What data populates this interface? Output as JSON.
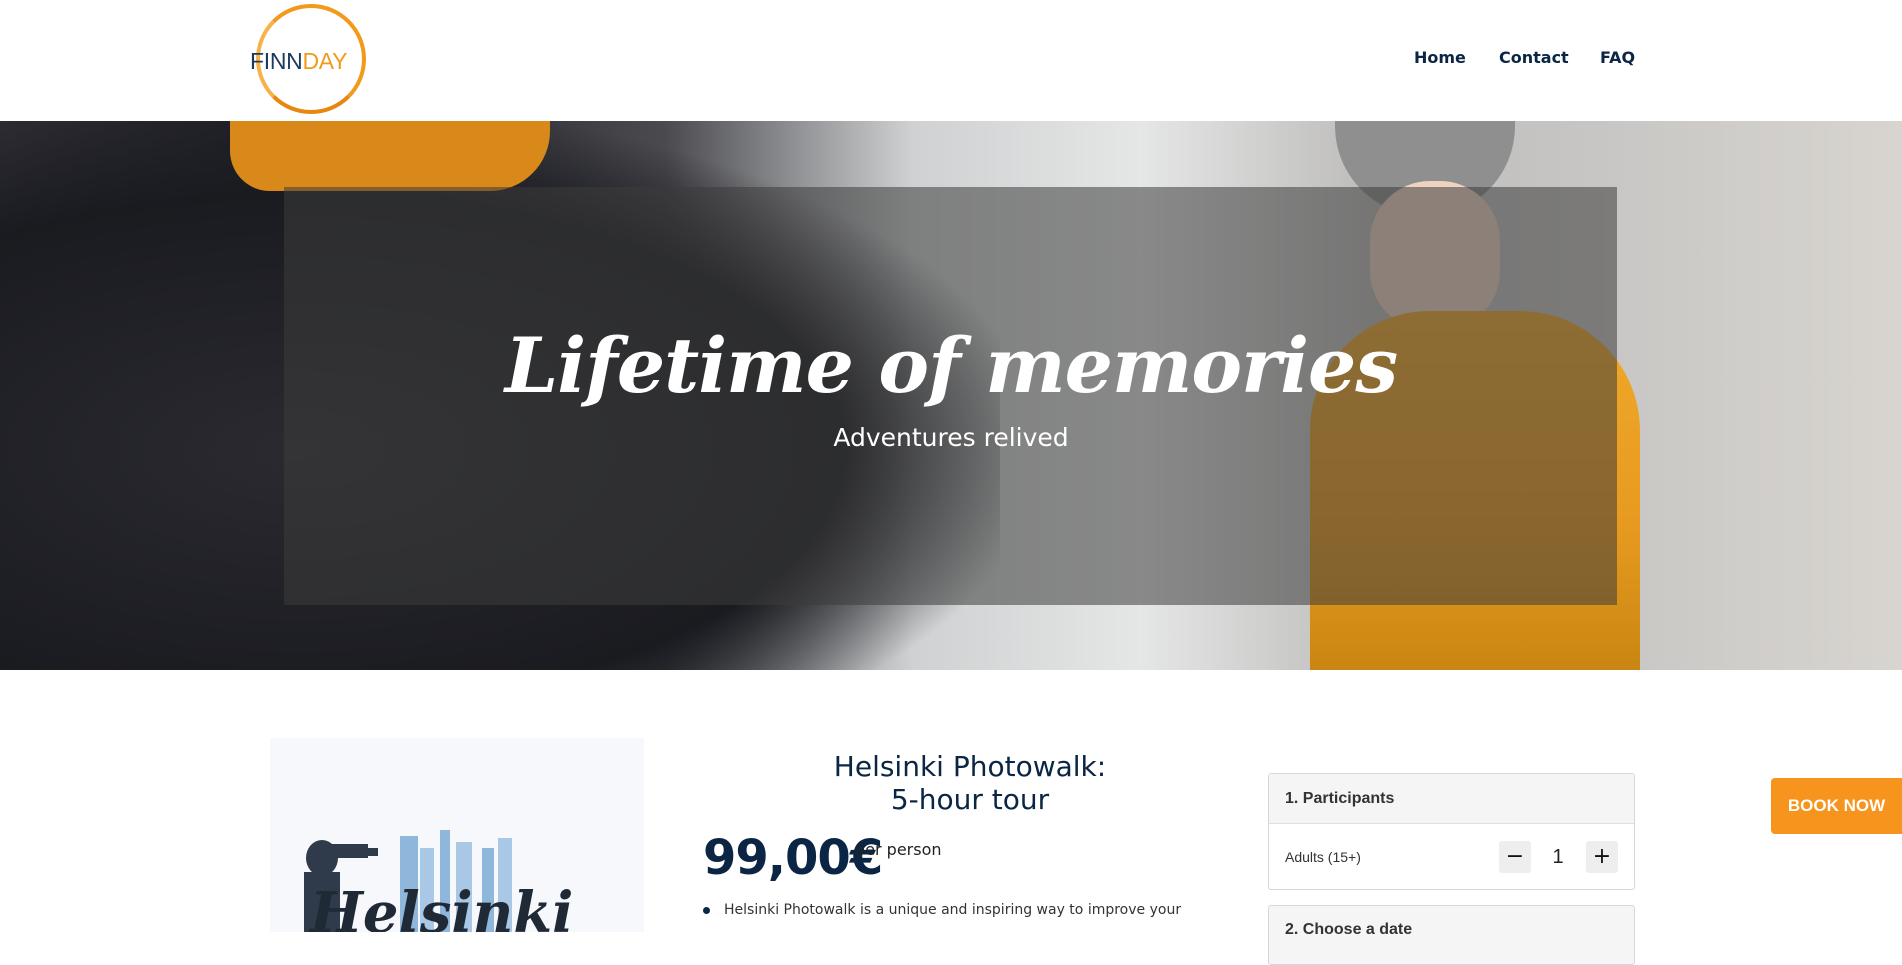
{
  "header": {
    "logo": {
      "text_a": "FINN",
      "text_b": "DAY"
    },
    "nav": [
      {
        "label": "Home"
      },
      {
        "label": "Contact"
      },
      {
        "label": "FAQ"
      }
    ]
  },
  "hero": {
    "title": "Lifetime of memories",
    "subtitle": "Adventures relived"
  },
  "product": {
    "poster_text": "Helsinki",
    "title_line1": "Helsinki Photowalk:",
    "title_line2": "5-hour tour",
    "price": "99,00€",
    "price_unit": "per person",
    "description": "Helsinki Photowalk is a unique and inspiring way to improve your"
  },
  "booking": {
    "step1_title": "1. Participants",
    "adults_label": "Adults (15+)",
    "quantity": "1",
    "minus_icon": "minus-icon",
    "plus_icon": "plus-icon",
    "step2_title": "2. Choose a date"
  },
  "cta": {
    "label": "BOOK NOW"
  },
  "colors": {
    "brand_orange": "#f7941d",
    "navy": "#0b2545"
  }
}
